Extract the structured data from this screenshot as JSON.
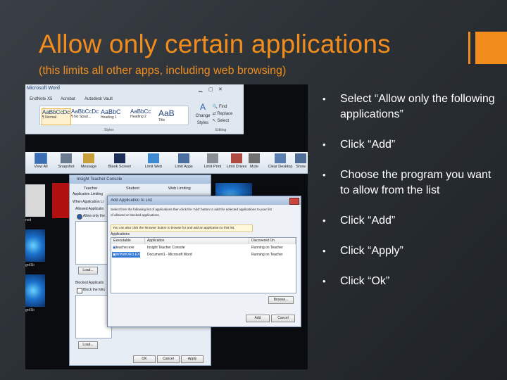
{
  "slide": {
    "title": "Allow only certain applications",
    "subtitle": "(this limits all other apps, including web browsing)",
    "accent_color": "#f28c1c",
    "bullets": [
      "Select “Allow only the following applications”",
      "Click “Add”",
      "Choose the program you want to allow from the list",
      "Click “Add”",
      "Click “Apply”",
      "Click “Ok”"
    ]
  },
  "word": {
    "title": "Microsoft Word",
    "tabs": [
      "EndNote X5",
      "Acrobat",
      "Autodesk Vault"
    ],
    "styles": [
      {
        "sample": "AaBbCcDc",
        "name": "¶ Normal"
      },
      {
        "sample": "AaBbCcDc",
        "name": "¶ No Spaci..."
      },
      {
        "sample": "AaBbC",
        "name": "Heading 1"
      },
      {
        "sample": "AaBbCc",
        "name": "Heading 2"
      },
      {
        "sample": "AaB",
        "name": "Title"
      }
    ],
    "change_styles": "Change Styles",
    "editing": [
      "Find",
      "Replace",
      "Select"
    ],
    "group_styles": "Styles",
    "group_editing": "Editing"
  },
  "toolbar": {
    "buttons": [
      "View All",
      "Snapshot",
      "Message",
      "Blank Screen",
      "Limit Web",
      "Limit Apps",
      "Limit Print",
      "Limit Drives",
      "Mute",
      "Clear Desktop",
      "Show"
    ]
  },
  "thumbs": [
    "ned",
    "grd1b",
    "grd1b"
  ],
  "console": {
    "title": "Insight Teacher Console",
    "tabs": [
      "Teacher",
      "Student",
      "Web Limiting"
    ],
    "section": "Application Limiting",
    "when_label": "When Application Li",
    "allowed_label": "Allowed Applicatio",
    "allow_only": "Allow only the",
    "load_button": "Load...",
    "blocked_label": "Blocked Applicatio",
    "block_the": "Block the follo",
    "load_button2": "Load...",
    "ok": "OK",
    "cancel": "Cancel",
    "apply": "Apply"
  },
  "add_dialog": {
    "title": "Add Application to List",
    "instr1": "Select from the following list of applications then click the 'Add' button to add the selected applications to your list",
    "instr2": "of allowed or blocked applications.",
    "info": "You can also click the 'Browse' button to browse for and add an application to this list.",
    "applications_label": "Applications",
    "columns": [
      "Executable",
      "Application",
      "Discovered On"
    ],
    "rows": [
      {
        "exe": "teacher.exe",
        "app": "Insight Teacher Console",
        "on": "Running on Teacher"
      },
      {
        "exe": "WINWORD.EXE",
        "app": "Document1 - Microsoft Word",
        "on": "Running on Teacher"
      }
    ],
    "browse": "Browse...",
    "add": "Add",
    "cancel": "Cancel"
  }
}
